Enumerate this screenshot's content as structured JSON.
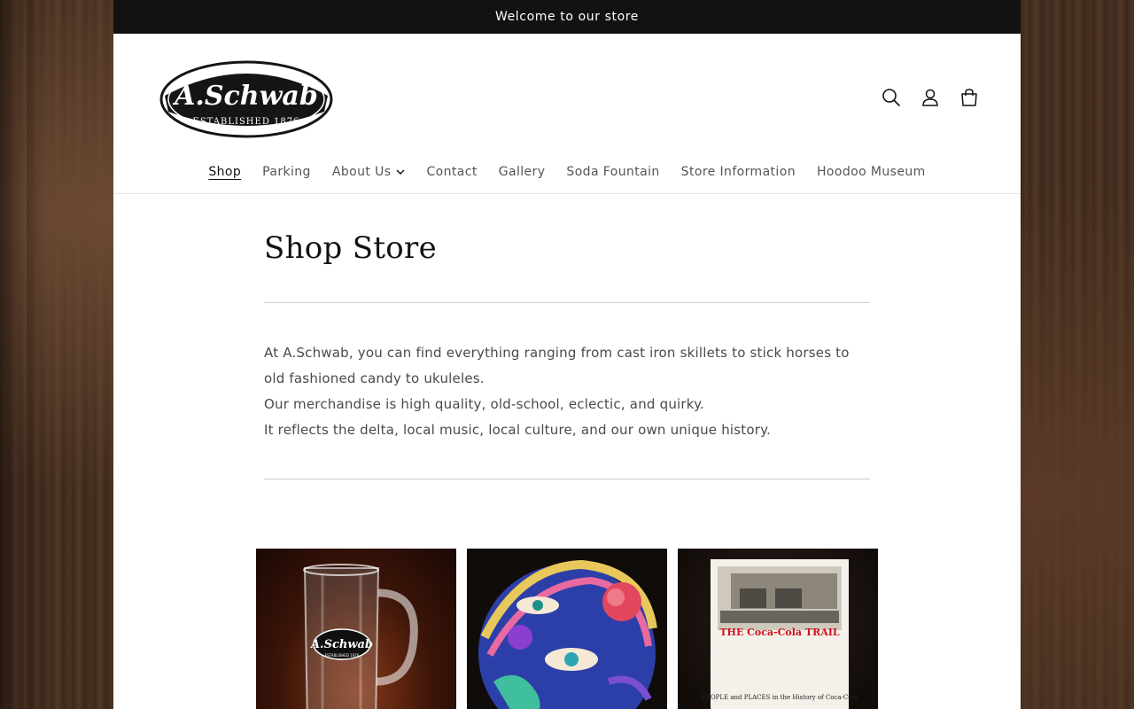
{
  "announcement": "Welcome to our store",
  "logo": {
    "name": "A.Schwab",
    "tagline": "ESTABLISHED 1876"
  },
  "header_icons": [
    "search-icon",
    "account-icon",
    "cart-icon"
  ],
  "nav": {
    "items": [
      {
        "label": "Shop",
        "active": true
      },
      {
        "label": "Parking"
      },
      {
        "label": "About Us",
        "has_dropdown": true
      },
      {
        "label": "Contact"
      },
      {
        "label": "Gallery"
      },
      {
        "label": "Soda Fountain"
      },
      {
        "label": "Store Information"
      },
      {
        "label": "Hoodoo Museum"
      }
    ]
  },
  "page": {
    "title": "Shop Store",
    "description": [
      "At A.Schwab, you can find everything ranging from cast iron skillets to stick horses to old fashioned candy to ukuleles.",
      "Our merchandise is high quality, old-school, eclectic, and quirky.",
      "It reflects the delta, local music, local culture, and our own unique history."
    ]
  },
  "products": [
    {
      "image_text": "A.Schwab",
      "image_subtext": "ESTABLISHED 1876"
    },
    {
      "image_text": ""
    },
    {
      "image_text": "THE Coca-Cola TRAIL",
      "image_subtext": "PEOPLE and PLACES in the History of Coca-Cola"
    }
  ],
  "colors": {
    "announcement_bg": "#121212",
    "text": "#121212",
    "muted": "#555555",
    "page_bg": "#ffffff"
  }
}
